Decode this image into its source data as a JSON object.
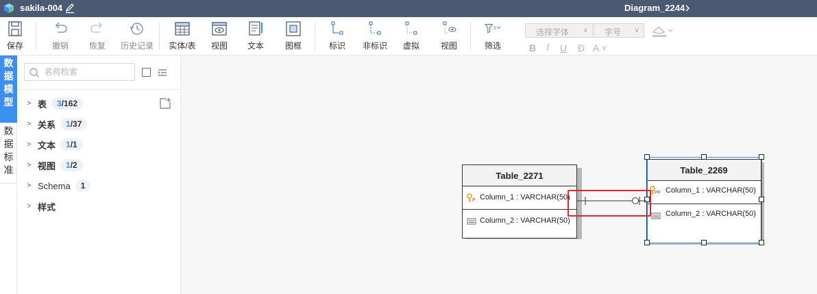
{
  "titlebar": {
    "project": "sakila-004",
    "diagram": "Diagram_2244"
  },
  "toolbar": {
    "save": "保存",
    "undo": "撤销",
    "redo": "恢复",
    "history": "历史记录",
    "entity": "实体/表",
    "view": "视图",
    "text": "文本",
    "frame": "图框",
    "identifying": "标识",
    "non_identifying": "非标识",
    "virtual": "虚拟",
    "view_rel": "视图",
    "filter": "筛选",
    "font_select": "选择字体",
    "font_size": "字号",
    "bold": "B",
    "italic": "I",
    "underline": "U",
    "strike": "Đ",
    "font_color": "A"
  },
  "nav": {
    "data_model": "数据模型",
    "data_standard": "数据标准"
  },
  "panel": {
    "search_placeholder": "名称检索",
    "tree": [
      {
        "label": "表",
        "count_hl": "3",
        "count_total": "/162"
      },
      {
        "label": "关系",
        "count_hl": "1",
        "count_total": "/37"
      },
      {
        "label": "文本",
        "count_hl": "1",
        "count_total": "/1"
      },
      {
        "label": "视图",
        "count_hl": "1",
        "count_total": "/2"
      },
      {
        "label": "Schema",
        "count_hl": "",
        "count_total": "1"
      },
      {
        "label": "样式"
      }
    ]
  },
  "diagram": {
    "entities": [
      {
        "name": "Table_2271",
        "columns": [
          {
            "key": "P",
            "text": "Column_1 : VARCHAR(50)"
          },
          {
            "key": "",
            "text": "Column_2 : VARCHAR(50)"
          }
        ]
      },
      {
        "name": "Table_2269",
        "columns": [
          {
            "key": "PF",
            "text": "Column_1 : VARCHAR(50)"
          },
          {
            "key": "",
            "text": "Column_2 : VARCHAR(50)"
          }
        ]
      }
    ]
  },
  "colors": {
    "titlebar": "#4a5a73",
    "accent": "#3b8ff0",
    "highlight": "#e0262c",
    "key": "#e0a21c"
  }
}
